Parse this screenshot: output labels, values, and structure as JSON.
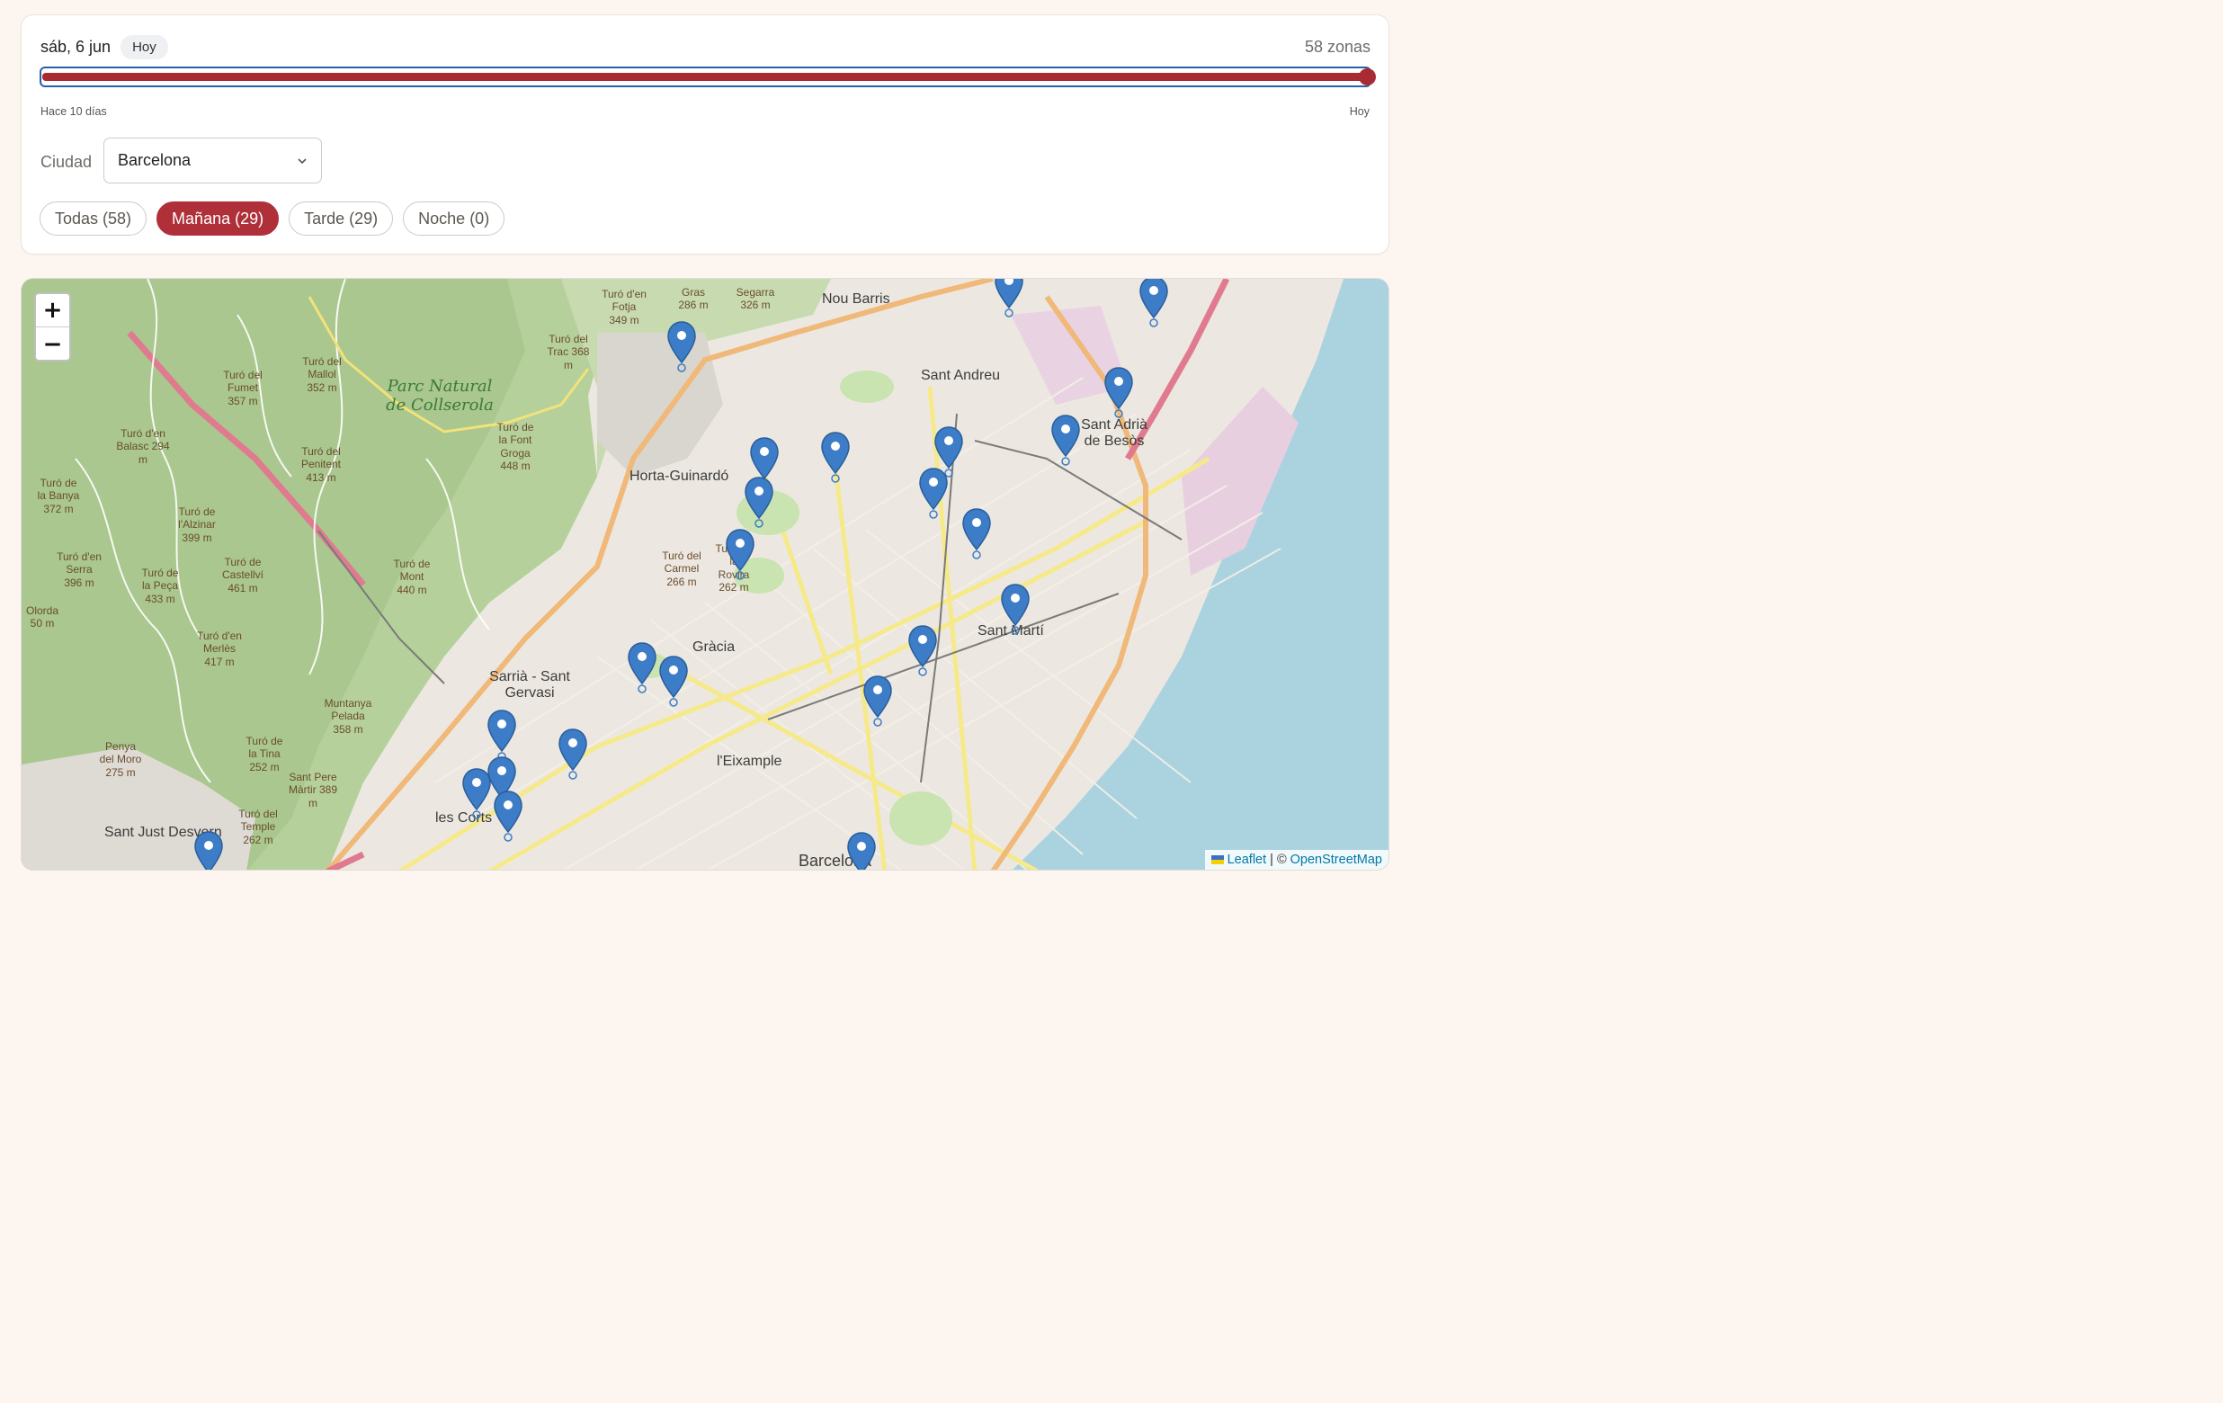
{
  "header": {
    "date": "sáb, 6 jun",
    "today_badge": "Hoy",
    "zone_count": "58 zonas"
  },
  "slider": {
    "value_fraction": 1.0,
    "start_label": "Hace 10 días",
    "end_label": "Hoy"
  },
  "city": {
    "label": "Ciudad",
    "selected": "Barcelona"
  },
  "filters": [
    {
      "label": "Todas (58)",
      "active": false
    },
    {
      "label": "Mañana (29)",
      "active": true
    },
    {
      "label": "Tarde (29)",
      "active": false
    },
    {
      "label": "Noche (0)",
      "active": false
    }
  ],
  "map": {
    "zoom_in": "+",
    "zoom_out": "−",
    "attribution": {
      "leaflet": "Leaflet",
      "separator": "|",
      "copyright": "©",
      "osm": "OpenStreetMap"
    },
    "marker_color": "#3d7cc6",
    "places": {
      "nou_barris": "Nou Barris",
      "sant_andreu": "Sant Andreu",
      "sant_adria": "Sant Adrià de Besòs",
      "horta": "Horta-Guinardó",
      "gracia": "Gràcia",
      "sarria": "Sarrià - Sant Gervasi",
      "sant_marti": "Sant Martí",
      "eixample": "l'Eixample",
      "les_corts": "les Corts",
      "sant_just": "Sant Just Desvern",
      "barcelona": "Barcelona",
      "parc": "Parc Natural de Collserola"
    },
    "peaks": [
      "Turó del Fumet 357 m",
      "Turó del Mallol 352 m",
      "Turó d'en Balasc 294 m",
      "Turó de la Banya 372 m",
      "Turó del Penitent 413 m",
      "Turó de la Font Groga 448 m",
      "Turó del Trac 368 m",
      "Turó d'en Fotja 349 m",
      "Turó de l'Alzinar 399 m",
      "Turó d'en Serra 396 m",
      "Turó de la Peça 433 m",
      "Turó de Castellví 461 m",
      "Turó de Mont 440 m",
      "Turó d'en Merlès 417 m",
      "Muntanya Pelada 358 m",
      "Penya del Moro 275 m",
      "Turó de la Tina 252 m",
      "Sant Pere Màrtir 389 m",
      "Turó del Temple 262 m",
      "Turó del Carmel 266 m",
      "Turó de la Rovira 262 m",
      "Gras 286 m",
      "Segarra 326 m",
      "Olorda 50 m"
    ]
  }
}
